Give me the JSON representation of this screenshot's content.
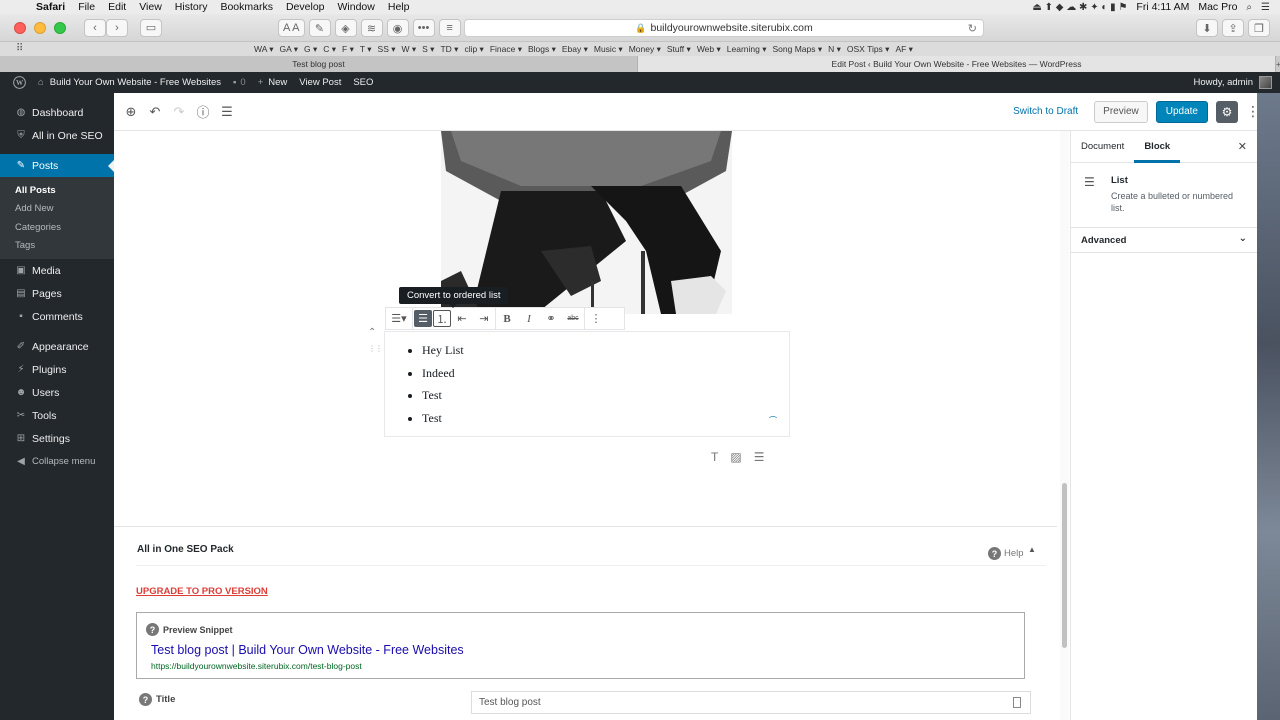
{
  "mac_menu": {
    "app": "Safari",
    "items": [
      "File",
      "Edit",
      "View",
      "History",
      "Bookmarks",
      "Develop",
      "Window",
      "Help"
    ],
    "clock": "Fri 4:11 AM",
    "user": "Mac Pro"
  },
  "safari": {
    "address": "buildyourownwebsite.siterubix.com",
    "favorites": [
      "WA ▾",
      "GA ▾",
      "G ▾",
      "C ▾",
      "F ▾",
      "T ▾",
      "SS ▾",
      "W ▾",
      "S ▾",
      "TD ▾",
      "clip ▾",
      "Finace ▾",
      "Blogs ▾",
      "Ebay ▾",
      "Music ▾",
      "Money ▾",
      "Stuff ▾",
      "Web ▾",
      "Learning ▾",
      "Song Maps ▾",
      "N ▾",
      "OSX Tips ▾",
      "AF ▾"
    ],
    "tabs": [
      "Test blog post",
      "Edit Post ‹ Build Your Own Website - Free Websites — WordPress"
    ]
  },
  "admin_bar": {
    "site_name": "Build Your Own Website - Free Websites",
    "comments_count": "0",
    "new_label": "New",
    "view_post_label": "View Post",
    "seo_label": "SEO",
    "howdy": "Howdy, admin"
  },
  "sidebar": {
    "items": [
      {
        "label": "Dashboard",
        "icon": "dashboard-icon"
      },
      {
        "label": "All in One SEO",
        "icon": "seo-shield-icon"
      },
      {
        "label": "Posts",
        "icon": "pin-icon"
      },
      {
        "label": "Media",
        "icon": "media-icon"
      },
      {
        "label": "Pages",
        "icon": "pages-icon"
      },
      {
        "label": "Comments",
        "icon": "comments-icon"
      },
      {
        "label": "Appearance",
        "icon": "brush-icon"
      },
      {
        "label": "Plugins",
        "icon": "plugin-icon"
      },
      {
        "label": "Users",
        "icon": "users-icon"
      },
      {
        "label": "Tools",
        "icon": "wrench-icon"
      },
      {
        "label": "Settings",
        "icon": "settings-icon"
      },
      {
        "label": "Collapse menu",
        "icon": "collapse-icon"
      }
    ],
    "posts_sub": [
      "All Posts",
      "Add New",
      "Categories",
      "Tags"
    ]
  },
  "editor_toolbar": {
    "switch_to_draft": "Switch to Draft",
    "preview": "Preview",
    "update": "Update"
  },
  "block": {
    "tooltip": "Convert to ordered list",
    "list_items": [
      "Hey List",
      "Indeed",
      "Test",
      "Test"
    ]
  },
  "seo_box": {
    "title": "All in One SEO Pack",
    "help": "Help",
    "upgrade": "UPGRADE TO PRO VERSION",
    "preview_snippet_label": "Preview Snippet",
    "snippet_title": "Test blog post | Build Your Own Website - Free Websites",
    "snippet_url": "https://buildyourownwebsite.siterubix.com/test-blog-post",
    "title_label": "Title",
    "title_value": "Test blog post"
  },
  "settings_sidebar": {
    "tabs": [
      "Document",
      "Block"
    ],
    "block_title": "List",
    "block_desc": "Create a bulleted or numbered list.",
    "advanced": "Advanced"
  },
  "colors": {
    "wp_admin_dark": "#23282d",
    "wp_blue": "#0073aa",
    "update_button": "#0085ba",
    "upgrade_red": "#dd3d36"
  }
}
